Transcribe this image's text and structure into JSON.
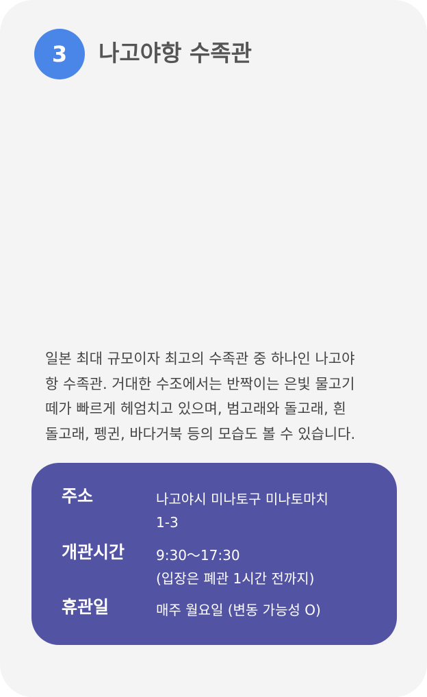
{
  "header": {
    "number": "3",
    "title": "나고야항 수족관"
  },
  "description": "일본 최대 규모이자 최고의 수족관 중 하나인 나고야\n항 수족관. 거대한 수조에서는 반짝이는 은빛 물고기\n떼가 빠르게 헤엄치고 있으며,  범고래와 돌고래, 흰\n돌고래, 펭귄, 바다거북 등의 모습도 볼 수 있습니다.",
  "info": {
    "address": {
      "label": "주소",
      "value": "나고야시 미나토구 미나토마치\n1-3"
    },
    "hours": {
      "label": "개관시간",
      "value": "9:30～17:30\n(입장은 폐관 1시간 전까지)"
    },
    "closed": {
      "label": "휴관일",
      "value": "매주 월요일 (변동 가능성 O)"
    }
  },
  "colors": {
    "badge": "#4a86e8",
    "info_box": "#5353a3",
    "card_background": "#f4f4f4"
  }
}
